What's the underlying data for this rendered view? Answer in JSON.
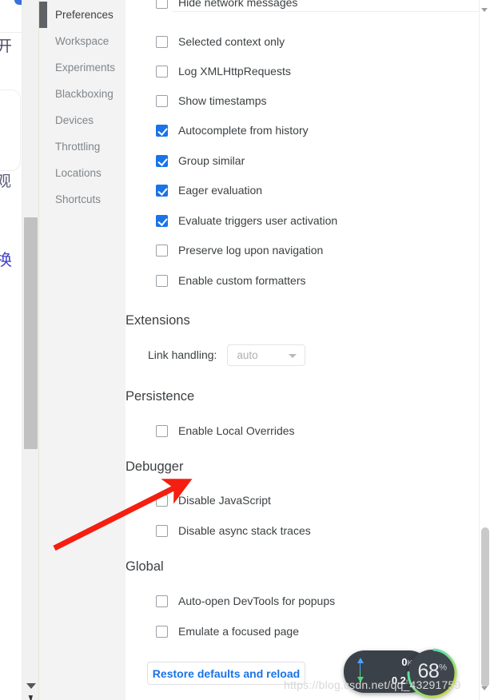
{
  "background_page": {
    "cjk_fragment_1": "开",
    "cjk_fragment_2": "观",
    "cjk_fragment_3": "换"
  },
  "devtools_settings": {
    "nav": {
      "items": [
        {
          "label": "Preferences",
          "selected": true
        },
        {
          "label": "Workspace",
          "selected": false
        },
        {
          "label": "Experiments",
          "selected": false
        },
        {
          "label": "Blackboxing",
          "selected": false
        },
        {
          "label": "Devices",
          "selected": false
        },
        {
          "label": "Throttling",
          "selected": false
        },
        {
          "label": "Locations",
          "selected": false
        },
        {
          "label": "Shortcuts",
          "selected": false
        }
      ]
    },
    "console_section": {
      "clipped_item": {
        "label": "Hide network messages",
        "checked": false
      },
      "items": [
        {
          "label": "Selected context only",
          "checked": false
        },
        {
          "label": "Log XMLHttpRequests",
          "checked": false
        },
        {
          "label": "Show timestamps",
          "checked": false
        },
        {
          "label": "Autocomplete from history",
          "checked": true
        },
        {
          "label": "Group similar",
          "checked": true
        },
        {
          "label": "Eager evaluation",
          "checked": true
        },
        {
          "label": "Evaluate triggers user activation",
          "checked": true
        },
        {
          "label": "Preserve log upon navigation",
          "checked": false
        },
        {
          "label": "Enable custom formatters",
          "checked": false
        }
      ]
    },
    "extensions_section": {
      "title": "Extensions",
      "link_handling_label": "Link handling:",
      "link_handling_value": "auto",
      "link_handling_options": [
        "auto"
      ]
    },
    "persistence_section": {
      "title": "Persistence",
      "items": [
        {
          "label": "Enable Local Overrides",
          "checked": false
        }
      ]
    },
    "debugger_section": {
      "title": "Debugger",
      "items": [
        {
          "label": "Disable JavaScript",
          "checked": false
        },
        {
          "label": "Disable async stack traces",
          "checked": false
        }
      ]
    },
    "global_section": {
      "title": "Global",
      "items": [
        {
          "label": "Auto-open DevTools for popups",
          "checked": false
        },
        {
          "label": "Emulate a focused page",
          "checked": false
        }
      ]
    },
    "restore_button_label": "Restore defaults and reload"
  },
  "annotation": {
    "arrow_color": "#f41f11",
    "points_at": "Disable JavaScript"
  },
  "floating_widget": {
    "upload_speed": "0",
    "upload_unit": "K/s",
    "download_speed": "0.2",
    "download_unit": "m/s",
    "gauge_value": "68",
    "gauge_unit": "%",
    "gauge_ring_start_color": "#38e0d0",
    "gauge_ring_end_color": "#e8d82a"
  },
  "watermark": "https://blog.csdn.net/qq_43291759",
  "colors": {
    "accent_blue": "#1a73e8",
    "nav_bg": "#f3f3f3",
    "text_primary": "#3c4043",
    "text_muted": "#80868b"
  }
}
